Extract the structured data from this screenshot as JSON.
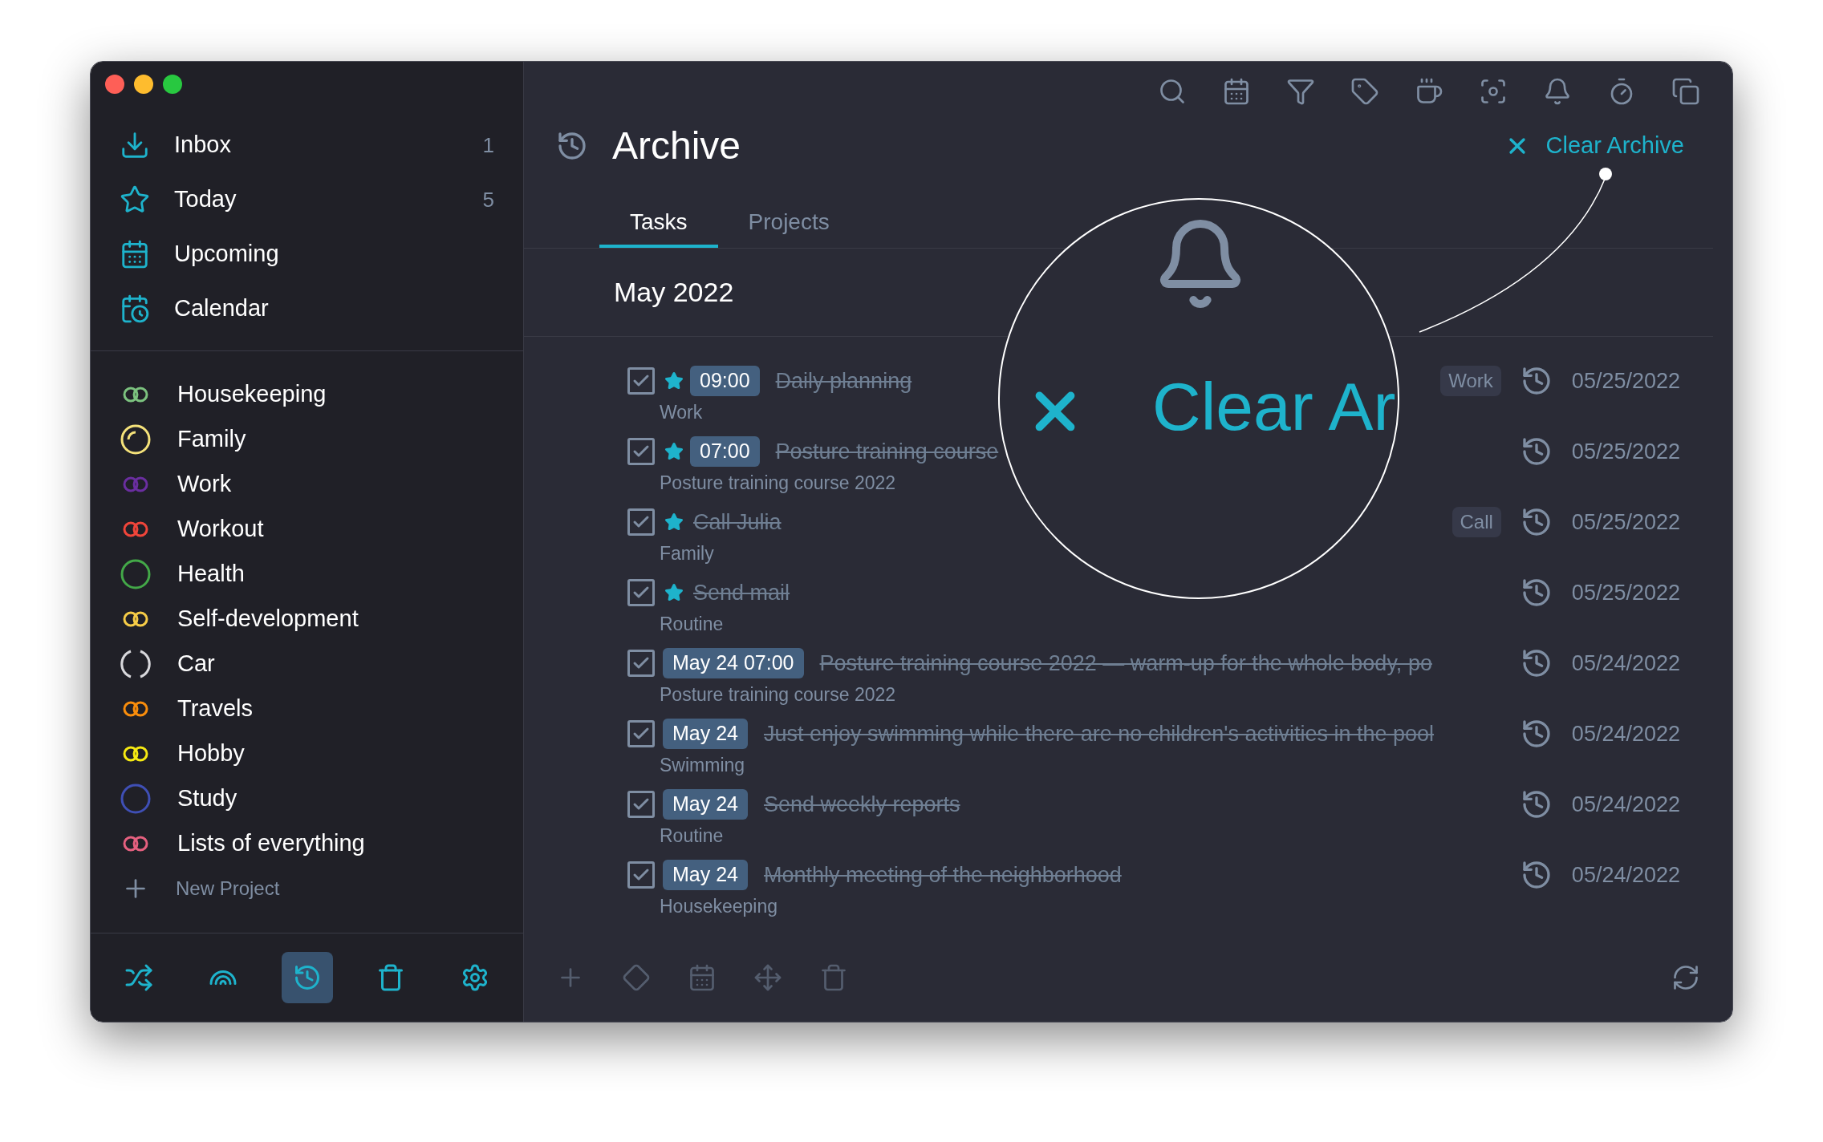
{
  "sidebar": {
    "nav": [
      {
        "kind": "inbox",
        "label": "Inbox",
        "count": "1"
      },
      {
        "kind": "star",
        "label": "Today",
        "count": "5"
      },
      {
        "kind": "calendar",
        "label": "Upcoming"
      },
      {
        "kind": "calendar-clock",
        "label": "Calendar"
      }
    ],
    "projects": [
      {
        "name": "Housekeeping",
        "kind": "double",
        "color": "#7cc27f"
      },
      {
        "name": "Family",
        "kind": "inner-arc",
        "color": "#f5e27a"
      },
      {
        "name": "Work",
        "kind": "double",
        "color": "#6a2ea0"
      },
      {
        "name": "Workout",
        "kind": "double",
        "color": "#f0453a"
      },
      {
        "name": "Health",
        "kind": "single",
        "color": "#43a848"
      },
      {
        "name": "Self-development",
        "kind": "double",
        "color": "#f6cc47"
      },
      {
        "name": "Car",
        "kind": "broken",
        "color": "#d8d8dc"
      },
      {
        "name": "Travels",
        "kind": "double",
        "color": "#f98d0c"
      },
      {
        "name": "Hobby",
        "kind": "double",
        "color": "#f6ea12"
      },
      {
        "name": "Study",
        "kind": "single",
        "color": "#3f4fb5"
      },
      {
        "name": "Lists of everything",
        "kind": "double",
        "color": "#e5607f"
      }
    ],
    "new_project": "New Project",
    "bottom_bar": [
      {
        "kind": "shuffle",
        "selected": false
      },
      {
        "kind": "rainbow",
        "selected": false
      },
      {
        "kind": "history",
        "selected": true
      },
      {
        "kind": "trash",
        "selected": false
      },
      {
        "kind": "gear",
        "selected": false
      }
    ]
  },
  "header": {
    "title": "Archive",
    "action": "Clear Archive"
  },
  "tabs": [
    {
      "label": "Tasks",
      "selected": true
    },
    {
      "label": "Projects",
      "selected": false
    }
  ],
  "section": "May 2022",
  "tasks": [
    {
      "checked": true,
      "starred": true,
      "time": "09:00",
      "title": "Daily planning",
      "project": "Work",
      "tag": "Work",
      "date": "05/25/2022"
    },
    {
      "checked": true,
      "starred": true,
      "time": "07:00",
      "title": "Posture training course",
      "project": "Posture training course 2022",
      "date": "05/25/2022"
    },
    {
      "checked": true,
      "starred": true,
      "title": "Call Julia",
      "project": "Family",
      "tag": "Call",
      "date": "05/25/2022"
    },
    {
      "checked": true,
      "starred": true,
      "title": "Send mail",
      "project": "Routine",
      "date": "05/25/2022"
    },
    {
      "checked": true,
      "starred": false,
      "time": "May 24 07:00",
      "title": "Posture training course 2022 — warm-up for the whole body, po",
      "project": "Posture training course 2022",
      "date": "05/24/2022"
    },
    {
      "checked": true,
      "starred": false,
      "time": "May 24",
      "title": "Just enjoy swimming while there are no children's activities in the pool",
      "project": "Swimming",
      "date": "05/24/2022"
    },
    {
      "checked": true,
      "starred": false,
      "time": "May 24",
      "title": "Send weekly reports",
      "project": "Routine",
      "date": "05/24/2022"
    },
    {
      "checked": true,
      "starred": false,
      "time": "May 24",
      "title": "Monthly meeting of the neighborhood",
      "project": "Housekeeping",
      "date": "05/24/2022"
    }
  ],
  "magnifier": {
    "text": "Clear Ar"
  }
}
